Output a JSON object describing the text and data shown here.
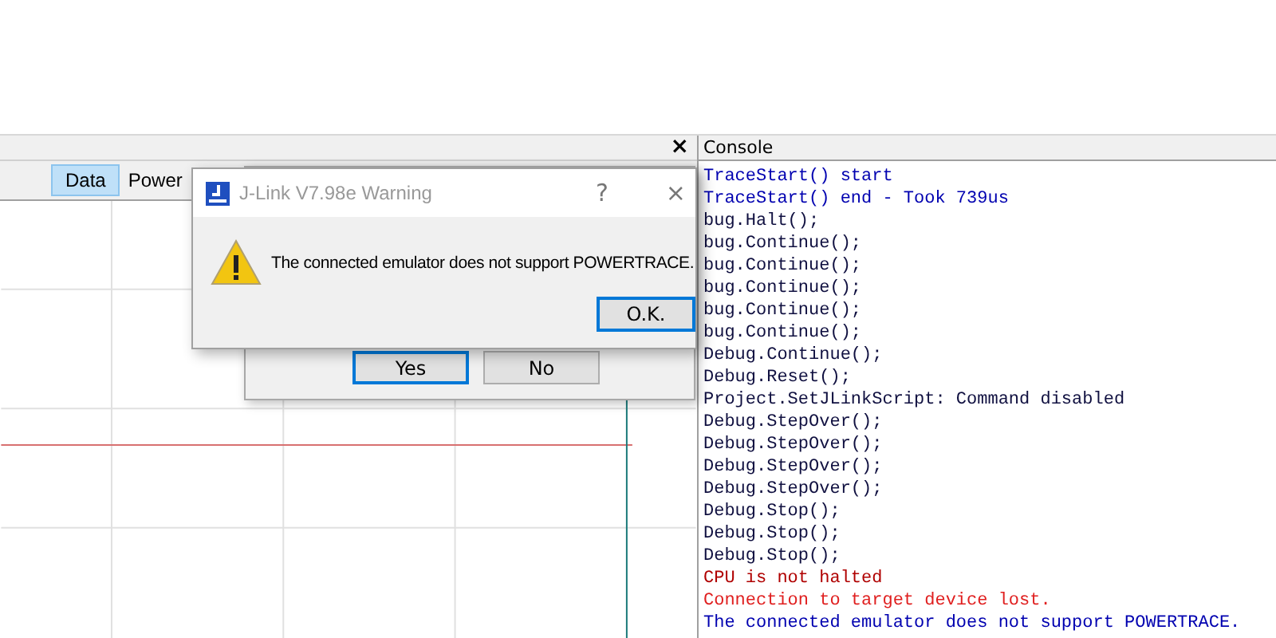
{
  "plot_panel": {
    "close": "×",
    "tabs": [
      {
        "label": "Data",
        "selected": true
      },
      {
        "label": "Power",
        "selected": false
      }
    ]
  },
  "console": {
    "title": "Console",
    "lines": [
      {
        "kind": "info",
        "text": "TraceStart() start"
      },
      {
        "kind": "info",
        "text": "TraceStart() end - Took 739us"
      },
      {
        "kind": "command",
        "text": "bug.Halt();"
      },
      {
        "kind": "command",
        "text": "bug.Continue();"
      },
      {
        "kind": "command",
        "text": "bug.Continue();"
      },
      {
        "kind": "command",
        "text": "bug.Continue();"
      },
      {
        "kind": "command",
        "text": "bug.Continue();"
      },
      {
        "kind": "command",
        "text": "bug.Continue();"
      },
      {
        "kind": "command",
        "text": "Debug.Continue();"
      },
      {
        "kind": "command",
        "text": "Debug.Reset();"
      },
      {
        "kind": "command",
        "text": "Project.SetJLinkScript: Command disabled"
      },
      {
        "kind": "command",
        "text": "Debug.StepOver();"
      },
      {
        "kind": "command",
        "text": "Debug.StepOver();"
      },
      {
        "kind": "command",
        "text": "Debug.StepOver();"
      },
      {
        "kind": "command",
        "text": "Debug.StepOver();"
      },
      {
        "kind": "command",
        "text": "Debug.Stop();"
      },
      {
        "kind": "command",
        "text": "Debug.Stop();"
      },
      {
        "kind": "command",
        "text": "Debug.Stop();"
      },
      {
        "kind": "fault",
        "text": "CPU is not halted"
      },
      {
        "kind": "error",
        "text": "Connection to target device lost."
      },
      {
        "kind": "info",
        "text": "The connected emulator does not support POWERTRACE."
      }
    ]
  },
  "back_dialog": {
    "buttons": [
      {
        "label": "Yes",
        "selected": true
      },
      {
        "label": "No",
        "selected": false
      }
    ]
  },
  "warning_dialog": {
    "title": "J-Link V7.98e Warning",
    "help": "?",
    "close": "×",
    "message": "The connected emulator does not support POWERTRACE.",
    "button": "O.K."
  }
}
